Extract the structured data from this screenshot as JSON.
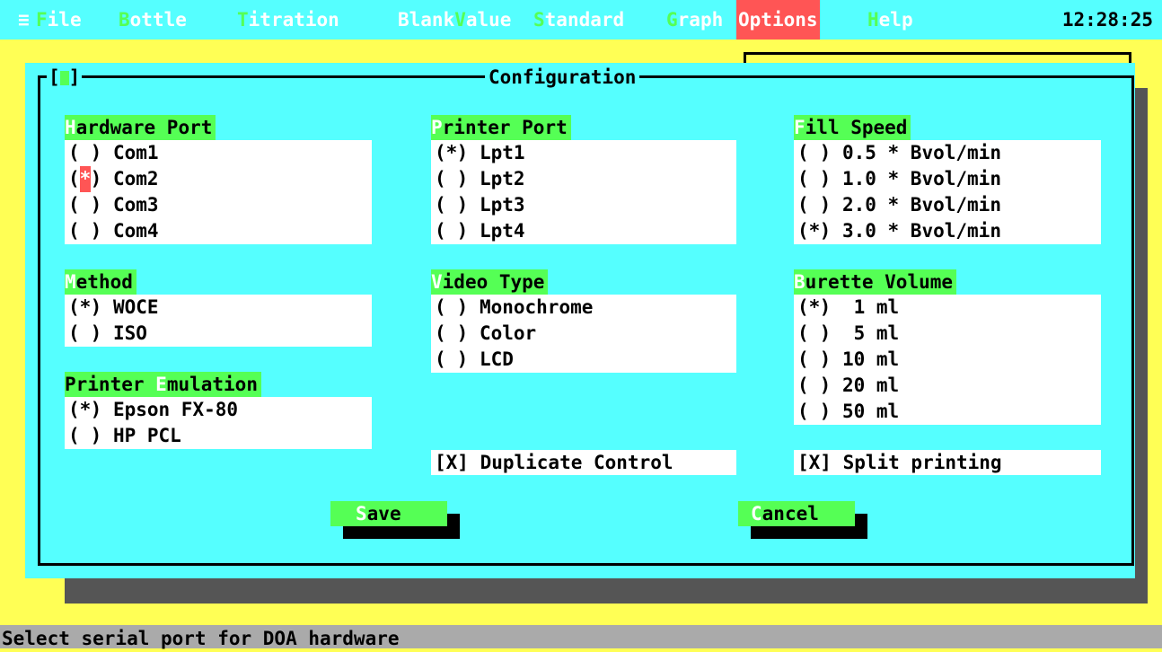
{
  "menubar": {
    "sys_icon": "≡",
    "items": [
      {
        "hot": "F",
        "rest": "ile"
      },
      {
        "hot": "B",
        "rest": "ottle"
      },
      {
        "hot": "T",
        "rest": "itration"
      },
      {
        "hot": "V",
        "prefix": "Blank",
        "rest": "alue"
      },
      {
        "hot": "S",
        "rest": "tandard"
      },
      {
        "hot": "G",
        "rest": "raph"
      },
      {
        "hot": "O",
        "rest": "ptions"
      },
      {
        "hot": "H",
        "rest": "elp"
      }
    ],
    "clock": "12:28:25"
  },
  "dialog": {
    "title": "Configuration",
    "close_left": "[",
    "close_right": "]"
  },
  "groups": {
    "hardware_port": {
      "hot": "H",
      "rest": "ardware Port",
      "options": [
        {
          "mark": " ",
          "label": "Com1"
        },
        {
          "mark": "*",
          "label": "Com2",
          "focused": true
        },
        {
          "mark": " ",
          "label": "Com3"
        },
        {
          "mark": " ",
          "label": "Com4"
        }
      ]
    },
    "printer_port": {
      "hot": "P",
      "rest": "rinter Port",
      "options": [
        {
          "mark": "*",
          "label": "Lpt1"
        },
        {
          "mark": " ",
          "label": "Lpt2"
        },
        {
          "mark": " ",
          "label": "Lpt3"
        },
        {
          "mark": " ",
          "label": "Lpt4"
        }
      ]
    },
    "fill_speed": {
      "hot": "F",
      "rest": "ill Speed",
      "options": [
        {
          "mark": " ",
          "label": "0.5 * Bvol/min"
        },
        {
          "mark": " ",
          "label": "1.0 * Bvol/min"
        },
        {
          "mark": " ",
          "label": "2.0 * Bvol/min"
        },
        {
          "mark": "*",
          "label": "3.0 * Bvol/min"
        }
      ]
    },
    "method": {
      "hot": "M",
      "rest": "ethod",
      "options": [
        {
          "mark": "*",
          "label": "WOCE"
        },
        {
          "mark": " ",
          "label": "ISO"
        }
      ]
    },
    "video_type": {
      "hot": "V",
      "rest": "ideo Type",
      "options": [
        {
          "mark": " ",
          "label": "Monochrome"
        },
        {
          "mark": " ",
          "label": "Color"
        },
        {
          "mark": " ",
          "label": "LCD"
        }
      ]
    },
    "burette_volume": {
      "hot": "B",
      "rest": "urette Volume",
      "options": [
        {
          "mark": "*",
          "label": " 1 ml"
        },
        {
          "mark": " ",
          "label": " 5 ml"
        },
        {
          "mark": " ",
          "label": "10 ml"
        },
        {
          "mark": " ",
          "label": "20 ml"
        },
        {
          "mark": " ",
          "label": "50 ml"
        }
      ]
    },
    "printer_emulation": {
      "prefix": "Printer ",
      "hot": "E",
      "rest": "mulation",
      "options": [
        {
          "mark": "*",
          "label": "Epson FX-80"
        },
        {
          "mark": " ",
          "label": "HP PCL"
        }
      ]
    }
  },
  "checkboxes": {
    "duplicate_control": "[X] Duplicate Control",
    "split_printing": "[X] Split printing"
  },
  "buttons": {
    "save": {
      "hot": "S",
      "rest": "ave"
    },
    "cancel": {
      "hot": "C",
      "rest": "ancel"
    }
  },
  "status": "Select serial port for DOA hardware"
}
